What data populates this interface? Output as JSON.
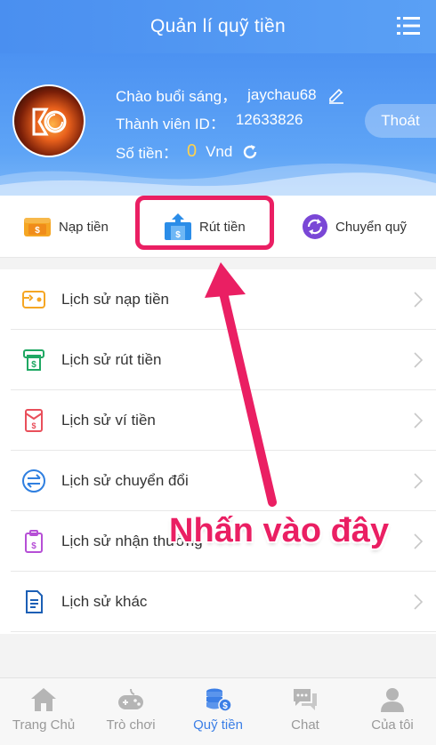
{
  "header": {
    "title": "Quản lí quỹ tiền",
    "menu_icon": "menu-icon"
  },
  "profile": {
    "greeting": "Chào buổi sáng，",
    "username": "jaychau68",
    "member_label": "Thành viên ID：",
    "member_id": "12633826",
    "balance_label": "Số tiền：",
    "balance_value": "0",
    "balance_unit": "Vnd",
    "logout_label": "Thoát"
  },
  "actions": [
    {
      "label": "Nạp tiền",
      "icon": "deposit-icon"
    },
    {
      "label": "Rút tiền",
      "icon": "withdraw-icon"
    },
    {
      "label": "Chuyển quỹ",
      "icon": "transfer-icon"
    }
  ],
  "history": [
    {
      "label": "Lịch sử nạp tiền",
      "icon": "deposit-history-icon"
    },
    {
      "label": "Lịch sử rút tiền",
      "icon": "withdraw-history-icon"
    },
    {
      "label": "Lịch sử ví tiền",
      "icon": "wallet-history-icon"
    },
    {
      "label": "Lịch sử chuyển đổi",
      "icon": "convert-history-icon"
    },
    {
      "label": "Lịch sử nhận thưởng",
      "icon": "reward-history-icon"
    },
    {
      "label": "Lịch sử khác",
      "icon": "other-history-icon"
    }
  ],
  "annotation": {
    "text": "Nhấn vào đây"
  },
  "nav": [
    {
      "label": "Trang Chủ",
      "icon": "home-icon"
    },
    {
      "label": "Trò chơi",
      "icon": "gamepad-icon"
    },
    {
      "label": "Quỹ tiền",
      "icon": "coins-icon",
      "active": true
    },
    {
      "label": "Chat",
      "icon": "chat-icon"
    },
    {
      "label": "Của tôi",
      "icon": "user-icon"
    }
  ],
  "colors": {
    "primary": "#4a8ff0",
    "highlight": "#ea1f63",
    "balance": "#ffd24d",
    "active_nav": "#3c7fe6"
  }
}
